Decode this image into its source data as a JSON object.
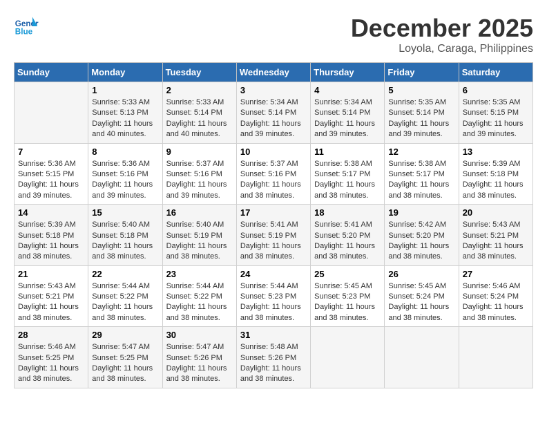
{
  "logo": {
    "line1": "General",
    "line2": "Blue"
  },
  "title": "December 2025",
  "location": "Loyola, Caraga, Philippines",
  "weekdays": [
    "Sunday",
    "Monday",
    "Tuesday",
    "Wednesday",
    "Thursday",
    "Friday",
    "Saturday"
  ],
  "weeks": [
    [
      {
        "day": "",
        "info": ""
      },
      {
        "day": "1",
        "info": "Sunrise: 5:33 AM\nSunset: 5:13 PM\nDaylight: 11 hours\nand 40 minutes."
      },
      {
        "day": "2",
        "info": "Sunrise: 5:33 AM\nSunset: 5:14 PM\nDaylight: 11 hours\nand 40 minutes."
      },
      {
        "day": "3",
        "info": "Sunrise: 5:34 AM\nSunset: 5:14 PM\nDaylight: 11 hours\nand 39 minutes."
      },
      {
        "day": "4",
        "info": "Sunrise: 5:34 AM\nSunset: 5:14 PM\nDaylight: 11 hours\nand 39 minutes."
      },
      {
        "day": "5",
        "info": "Sunrise: 5:35 AM\nSunset: 5:14 PM\nDaylight: 11 hours\nand 39 minutes."
      },
      {
        "day": "6",
        "info": "Sunrise: 5:35 AM\nSunset: 5:15 PM\nDaylight: 11 hours\nand 39 minutes."
      }
    ],
    [
      {
        "day": "7",
        "info": "Sunrise: 5:36 AM\nSunset: 5:15 PM\nDaylight: 11 hours\nand 39 minutes."
      },
      {
        "day": "8",
        "info": "Sunrise: 5:36 AM\nSunset: 5:16 PM\nDaylight: 11 hours\nand 39 minutes."
      },
      {
        "day": "9",
        "info": "Sunrise: 5:37 AM\nSunset: 5:16 PM\nDaylight: 11 hours\nand 39 minutes."
      },
      {
        "day": "10",
        "info": "Sunrise: 5:37 AM\nSunset: 5:16 PM\nDaylight: 11 hours\nand 38 minutes."
      },
      {
        "day": "11",
        "info": "Sunrise: 5:38 AM\nSunset: 5:17 PM\nDaylight: 11 hours\nand 38 minutes."
      },
      {
        "day": "12",
        "info": "Sunrise: 5:38 AM\nSunset: 5:17 PM\nDaylight: 11 hours\nand 38 minutes."
      },
      {
        "day": "13",
        "info": "Sunrise: 5:39 AM\nSunset: 5:18 PM\nDaylight: 11 hours\nand 38 minutes."
      }
    ],
    [
      {
        "day": "14",
        "info": "Sunrise: 5:39 AM\nSunset: 5:18 PM\nDaylight: 11 hours\nand 38 minutes."
      },
      {
        "day": "15",
        "info": "Sunrise: 5:40 AM\nSunset: 5:18 PM\nDaylight: 11 hours\nand 38 minutes."
      },
      {
        "day": "16",
        "info": "Sunrise: 5:40 AM\nSunset: 5:19 PM\nDaylight: 11 hours\nand 38 minutes."
      },
      {
        "day": "17",
        "info": "Sunrise: 5:41 AM\nSunset: 5:19 PM\nDaylight: 11 hours\nand 38 minutes."
      },
      {
        "day": "18",
        "info": "Sunrise: 5:41 AM\nSunset: 5:20 PM\nDaylight: 11 hours\nand 38 minutes."
      },
      {
        "day": "19",
        "info": "Sunrise: 5:42 AM\nSunset: 5:20 PM\nDaylight: 11 hours\nand 38 minutes."
      },
      {
        "day": "20",
        "info": "Sunrise: 5:43 AM\nSunset: 5:21 PM\nDaylight: 11 hours\nand 38 minutes."
      }
    ],
    [
      {
        "day": "21",
        "info": "Sunrise: 5:43 AM\nSunset: 5:21 PM\nDaylight: 11 hours\nand 38 minutes."
      },
      {
        "day": "22",
        "info": "Sunrise: 5:44 AM\nSunset: 5:22 PM\nDaylight: 11 hours\nand 38 minutes."
      },
      {
        "day": "23",
        "info": "Sunrise: 5:44 AM\nSunset: 5:22 PM\nDaylight: 11 hours\nand 38 minutes."
      },
      {
        "day": "24",
        "info": "Sunrise: 5:44 AM\nSunset: 5:23 PM\nDaylight: 11 hours\nand 38 minutes."
      },
      {
        "day": "25",
        "info": "Sunrise: 5:45 AM\nSunset: 5:23 PM\nDaylight: 11 hours\nand 38 minutes."
      },
      {
        "day": "26",
        "info": "Sunrise: 5:45 AM\nSunset: 5:24 PM\nDaylight: 11 hours\nand 38 minutes."
      },
      {
        "day": "27",
        "info": "Sunrise: 5:46 AM\nSunset: 5:24 PM\nDaylight: 11 hours\nand 38 minutes."
      }
    ],
    [
      {
        "day": "28",
        "info": "Sunrise: 5:46 AM\nSunset: 5:25 PM\nDaylight: 11 hours\nand 38 minutes."
      },
      {
        "day": "29",
        "info": "Sunrise: 5:47 AM\nSunset: 5:25 PM\nDaylight: 11 hours\nand 38 minutes."
      },
      {
        "day": "30",
        "info": "Sunrise: 5:47 AM\nSunset: 5:26 PM\nDaylight: 11 hours\nand 38 minutes."
      },
      {
        "day": "31",
        "info": "Sunrise: 5:48 AM\nSunset: 5:26 PM\nDaylight: 11 hours\nand 38 minutes."
      },
      {
        "day": "",
        "info": ""
      },
      {
        "day": "",
        "info": ""
      },
      {
        "day": "",
        "info": ""
      }
    ]
  ]
}
